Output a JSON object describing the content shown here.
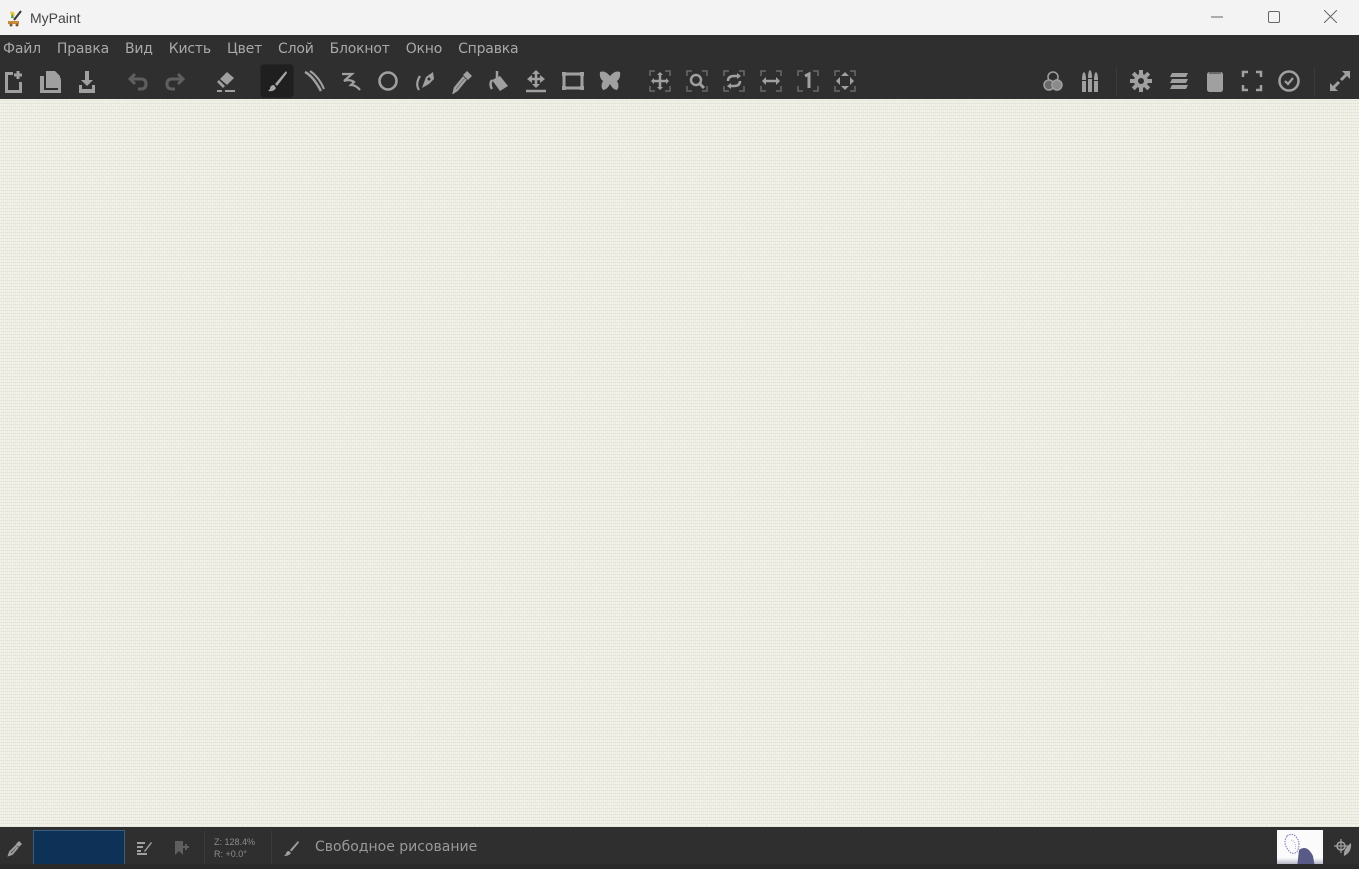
{
  "window": {
    "title": "MyPaint",
    "controls": {
      "minimize": "minimize-icon",
      "maximize": "maximize-icon",
      "close": "close-icon"
    }
  },
  "menubar": {
    "items": [
      {
        "label": "Файл"
      },
      {
        "label": "Правка"
      },
      {
        "label": "Вид"
      },
      {
        "label": "Кисть"
      },
      {
        "label": "Цвет"
      },
      {
        "label": "Слой"
      },
      {
        "label": "Блокнот"
      },
      {
        "label": "Окно"
      },
      {
        "label": "Справка"
      }
    ]
  },
  "toolbar": {
    "file_tools": [
      {
        "name": "new-document",
        "icon": "new-document-icon"
      },
      {
        "name": "open-document",
        "icon": "open-folder-icon"
      },
      {
        "name": "save-document",
        "icon": "save-download-icon"
      }
    ],
    "history_tools": [
      {
        "name": "undo",
        "icon": "undo-icon",
        "enabled": false
      },
      {
        "name": "redo",
        "icon": "redo-icon",
        "enabled": false
      }
    ],
    "paint_tools": [
      {
        "name": "eraser-mode",
        "icon": "eraser-icon"
      },
      {
        "name": "freehand-brush",
        "icon": "brush-icon",
        "active": true
      },
      {
        "name": "inking",
        "icon": "ink-curves-icon"
      },
      {
        "name": "lines-curves",
        "icon": "squiggle-line-icon"
      },
      {
        "name": "ellipse",
        "icon": "ellipse-icon"
      },
      {
        "name": "pen-inking",
        "icon": "fountain-pen-icon"
      },
      {
        "name": "color-picker",
        "icon": "eyedropper-icon"
      },
      {
        "name": "flood-fill",
        "icon": "paint-bucket-icon"
      },
      {
        "name": "move-layer",
        "icon": "move-layer-icon"
      },
      {
        "name": "frame",
        "icon": "frame-icon"
      },
      {
        "name": "symmetry",
        "icon": "butterfly-icon"
      }
    ],
    "view_tools": [
      {
        "name": "pan-view",
        "icon": "pan-arrows-icon"
      },
      {
        "name": "zoom-view",
        "icon": "zoom-magnifier-icon"
      },
      {
        "name": "rotate-view",
        "icon": "rotate-icon"
      },
      {
        "name": "mirror-view",
        "icon": "horizontal-flip-icon"
      },
      {
        "name": "reset-zoom",
        "icon": "one-to-one-icon"
      },
      {
        "name": "fit-view",
        "icon": "fit-view-icon"
      }
    ],
    "panel_tools": [
      {
        "name": "color-panel",
        "icon": "color-circles-icon"
      },
      {
        "name": "brushes-panel",
        "icon": "brushes-icon"
      },
      {
        "name": "settings-panel",
        "icon": "gear-icon"
      },
      {
        "name": "layers-panel",
        "icon": "layers-icon"
      },
      {
        "name": "scratchpad-panel",
        "icon": "notepad-icon"
      },
      {
        "name": "fullscreen",
        "icon": "fullscreen-brackets-icon"
      },
      {
        "name": "history-panel",
        "icon": "clock-icon"
      },
      {
        "name": "expand-window",
        "icon": "expand-arrows-icon"
      }
    ]
  },
  "statusbar": {
    "picker_icon": "eyedropper-icon",
    "current_color": "#0e3158",
    "brush_edit_icon": "brush-edit-icon",
    "bookmark_icon": "bookmark-add-icon",
    "zoom_label": "Z: 128.4%",
    "rotation_label": "R: +0.0°",
    "mode_icon": "brush-icon",
    "mode_label": "Свободное рисование",
    "preview_icon": "brush-preview-thumbnail",
    "symmetry_icon": "target-leaf-icon"
  },
  "colors": {
    "titlebar_bg": "#f3f3f3",
    "chrome_bg": "#2f2f2f",
    "icon_color": "#a0a0a0",
    "canvas_paper": "#eeeee4"
  }
}
